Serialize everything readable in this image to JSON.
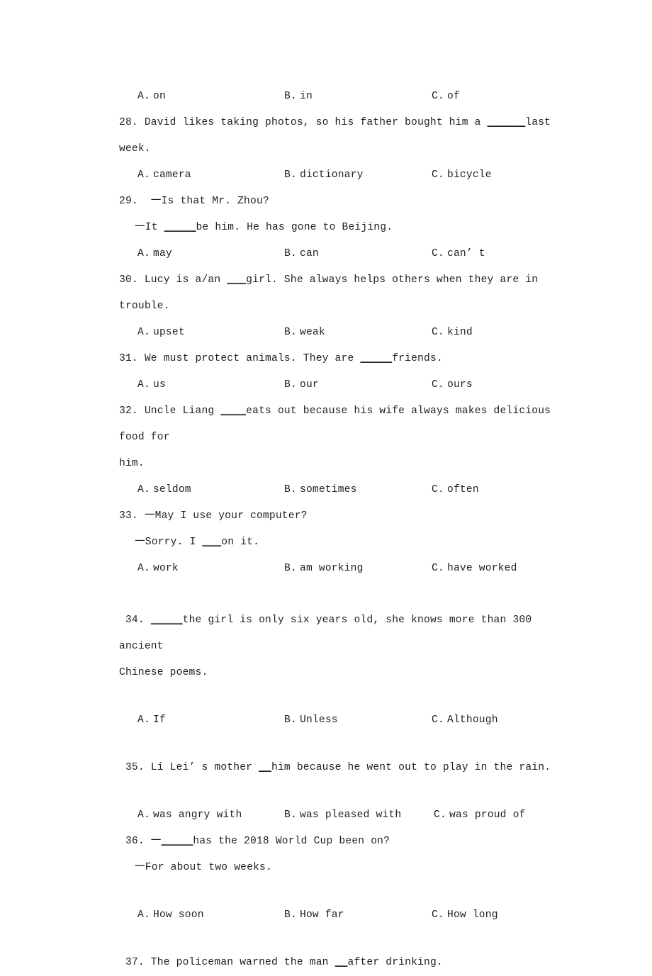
{
  "document": {
    "type": "english-grammar-exam-worksheet",
    "font_style": "monospace-serif-scan",
    "background_color": "#ffffff",
    "text_color": "#1f1f1f"
  },
  "questions": [
    {
      "id": "q27-options",
      "number": "",
      "options_only": true,
      "options": [
        {
          "label": "A.",
          "text": "on"
        },
        {
          "label": "B.",
          "text": "in"
        },
        {
          "label": "C.",
          "text": "of"
        }
      ]
    },
    {
      "id": "q28",
      "number": "28.",
      "stem": "28. David likes taking photos, so his father bought him a ",
      "blank": "______",
      "stem_tail": "last week.",
      "options": [
        {
          "label": "A.",
          "text": "camera"
        },
        {
          "label": "B.",
          "text": "dictionary"
        },
        {
          "label": "C.",
          "text": "bicycle"
        }
      ]
    },
    {
      "id": "q29",
      "number": "29.",
      "stem": "29.  一Is that Mr. Zhou?",
      "dialog_lead": "一It ",
      "dialog_blank": "_____",
      "dialog_tail": "be him. He has gone to Beijing.",
      "options": [
        {
          "label": "A.",
          "text": "may"
        },
        {
          "label": "B.",
          "text": "can"
        },
        {
          "label": "C.",
          "text": "can’ t"
        }
      ]
    },
    {
      "id": "q30",
      "number": "30.",
      "stem": "30. Lucy is a/an ",
      "blank": "___",
      "stem_tail": "girl. She always helps others when they are in trouble.",
      "options": [
        {
          "label": "A.",
          "text": "upset"
        },
        {
          "label": "B.",
          "text": "weak"
        },
        {
          "label": "C.",
          "text": "kind"
        }
      ]
    },
    {
      "id": "q31",
      "number": "31.",
      "stem": "31. We must protect animals. They are ",
      "blank": "_____",
      "stem_tail": "friends.",
      "options": [
        {
          "label": "A.",
          "text": "us"
        },
        {
          "label": "B.",
          "text": "our"
        },
        {
          "label": "C.",
          "text": "ours"
        }
      ]
    },
    {
      "id": "q32",
      "number": "32.",
      "stem": "32. Uncle Liang ",
      "blank": "____",
      "stem_tail": "eats out because his wife always makes delicious food for",
      "continuation": "him.",
      "options": [
        {
          "label": "A.",
          "text": "seldom"
        },
        {
          "label": "B.",
          "text": "sometimes"
        },
        {
          "label": "C.",
          "text": "often"
        }
      ]
    },
    {
      "id": "q33",
      "number": "33.",
      "stem": "33. 一May I use your computer?",
      "dialog_lead": "一Sorry. I ",
      "dialog_blank": "___",
      "dialog_tail": "on it.",
      "options": [
        {
          "label": "A.",
          "text": "work"
        },
        {
          "label": "B.",
          "text": "am working"
        },
        {
          "label": "C.",
          "text": "have worked"
        }
      ]
    },
    {
      "id": "q34",
      "number": "34.",
      "stem": " 34. ",
      "blank": "_____",
      "stem_tail": "the girl is only six years old, she knows more than 300 ancient",
      "continuation": "Chinese poems.",
      "options": [
        {
          "label": "A.",
          "text": "If"
        },
        {
          "label": "B.",
          "text": "Unless"
        },
        {
          "label": "C.",
          "text": "Although"
        }
      ]
    },
    {
      "id": "q35",
      "number": "35.",
      "stem": " 35. Li Lei’ s mother ",
      "blank": "__",
      "stem_tail": "him because he went out to play in the rain.",
      "options": [
        {
          "label": "A.",
          "text": "was angry with"
        },
        {
          "label": "B.",
          "text": "was pleased with"
        },
        {
          "label": "C.",
          "text": "was proud of"
        }
      ]
    },
    {
      "id": "q36",
      "number": "36.",
      "stem": " 36. 一",
      "blank": "_____",
      "stem_tail": "has the 2018 World Cup been on?",
      "dialog_lead": "一For about two weeks.",
      "options": [
        {
          "label": "A.",
          "text": "How soon"
        },
        {
          "label": "B.",
          "text": "How far"
        },
        {
          "label": "C.",
          "text": "How long"
        }
      ]
    },
    {
      "id": "q37",
      "number": "37.",
      "stem": " 37. The policeman warned the man ",
      "blank": "__",
      "stem_tail": "after drinking.",
      "options": []
    }
  ]
}
